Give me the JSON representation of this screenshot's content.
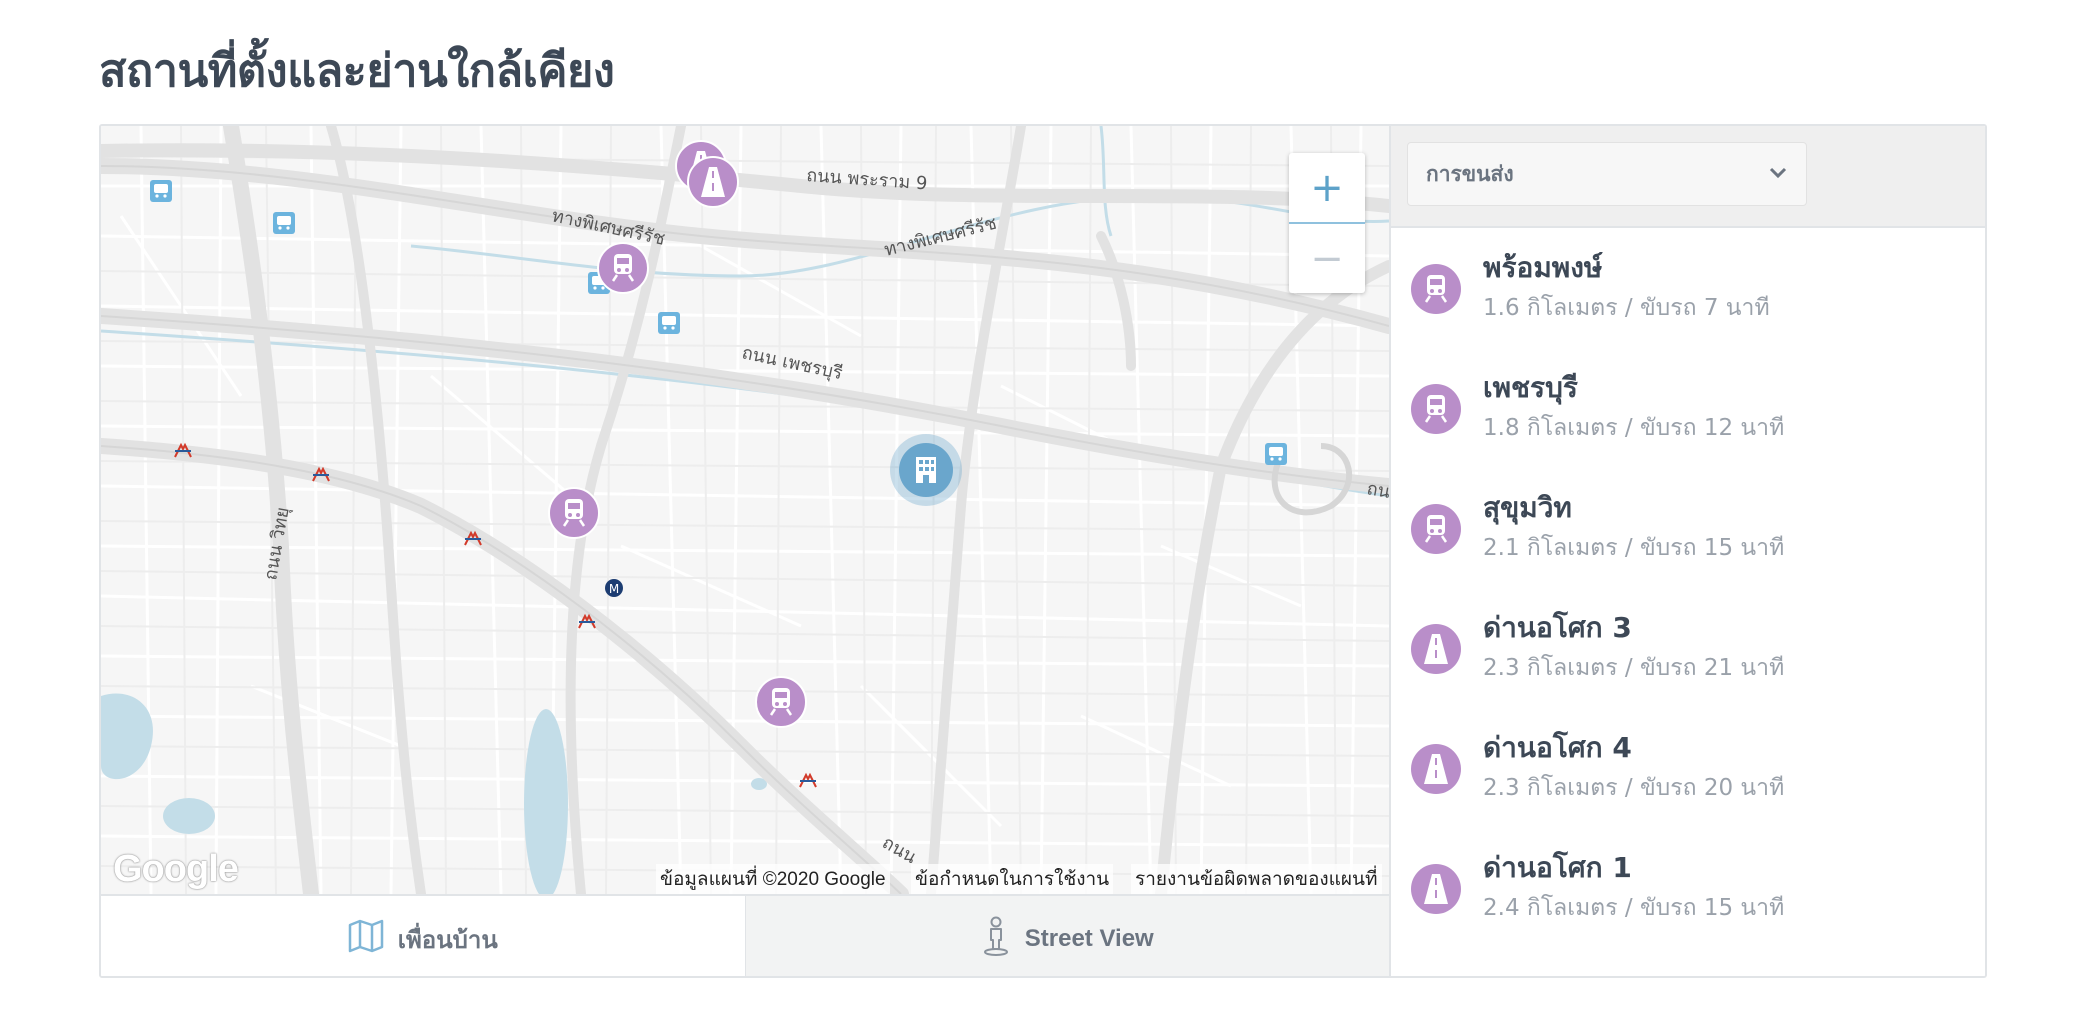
{
  "page": {
    "title": "สถานที่ตั้งและย่านใกล้เคียง"
  },
  "map": {
    "road_labels": {
      "rama9": "ถนน พระราม 9",
      "expressway_1": "ทางพิเศษศรีรัช",
      "expressway_2": "ทางพิเศษศรีรัช",
      "phetchaburi": "ถนน เพชรบุรี",
      "witthayu": "ถนน วิทยุ",
      "bottom": "ถนน",
      "edge": "ถน"
    },
    "google_logo": "Google",
    "credits": {
      "map_data": "ข้อมูลแผนที่ ©2020 Google",
      "terms": "ข้อกำหนดในการใช้งาน",
      "report": "รายงานข้อผิดพลาดของแผนที่"
    },
    "zoom": {
      "in": "+",
      "out": "−"
    },
    "colors": {
      "transit_marker": "#b98ec9",
      "property_marker": "#6aa6cc",
      "background": "#f6f6f6",
      "water": "#c3dde8"
    }
  },
  "tabs": {
    "neighbors": {
      "label": "เพื่อนบ้าน",
      "icon": "map-icon"
    },
    "street_view": {
      "label": "Street View",
      "icon": "pegman-icon"
    }
  },
  "sidebar": {
    "category_select": {
      "value": "การขนส่ง"
    },
    "places": [
      {
        "name": "พร้อมพงษ์",
        "distance": "1.6 กิโลเมตร / ขับรถ 7 นาที",
        "icon": "train-icon"
      },
      {
        "name": "เพชรบุรี",
        "distance": "1.8 กิโลเมตร / ขับรถ 12 นาที",
        "icon": "train-icon"
      },
      {
        "name": "สุขุมวิท",
        "distance": "2.1 กิโลเมตร / ขับรถ 15 นาที",
        "icon": "train-icon"
      },
      {
        "name": "ด่านอโศก 3",
        "distance": "2.3 กิโลเมตร / ขับรถ 21 นาที",
        "icon": "road-icon"
      },
      {
        "name": "ด่านอโศก 4",
        "distance": "2.3 กิโลเมตร / ขับรถ 20 นาที",
        "icon": "road-icon"
      },
      {
        "name": "ด่านอโศก 1",
        "distance": "2.4 กิโลเมตร / ขับรถ 15 นาที",
        "icon": "road-icon"
      }
    ]
  }
}
